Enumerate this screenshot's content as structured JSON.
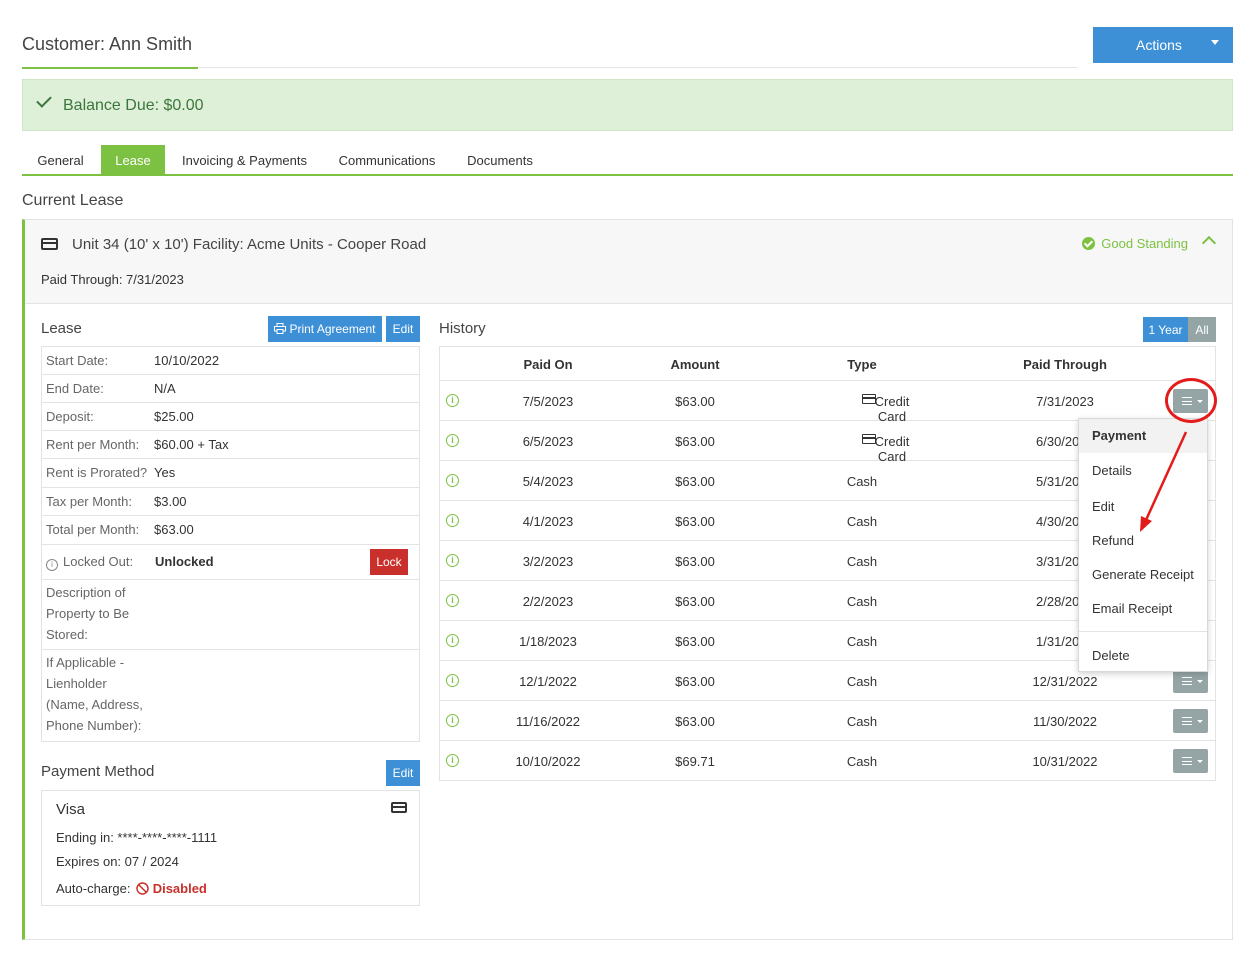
{
  "header": {
    "title": "Customer:  Ann Smith",
    "actions_label": "Actions"
  },
  "balance": {
    "text": "Balance Due:  $0.00"
  },
  "tabs": [
    {
      "label": "General"
    },
    {
      "label": "Lease"
    },
    {
      "label": "Invoicing & Payments"
    },
    {
      "label": "Communications"
    },
    {
      "label": "Documents"
    }
  ],
  "active_tab": "Lease",
  "current_lease_title": "Current Lease",
  "unit": {
    "title": "Unit 34 (10' x 10') Facility: Acme Units - Cooper Road",
    "paid_through": "Paid Through: 7/31/2023",
    "status": "Good Standing"
  },
  "lease": {
    "title": "Lease",
    "print_label": "Print Agreement",
    "edit_label": "Edit",
    "rows": [
      {
        "k": "Start Date:",
        "v": "10/10/2022"
      },
      {
        "k": "End Date:",
        "v": "N/A"
      },
      {
        "k": "Deposit:",
        "v": "$25.00"
      },
      {
        "k": "Rent per Month:",
        "v": "$60.00 + Tax"
      },
      {
        "k": "Rent is Prorated?",
        "v": "Yes"
      },
      {
        "k": "Tax per Month:",
        "v": "$3.00"
      },
      {
        "k": "Total per Month:",
        "v": "$63.00"
      }
    ],
    "locked_out_label": "Locked Out:",
    "locked_out_value": "Unlocked",
    "lock_label": "Lock",
    "description_label_1": "Description of",
    "description_label_2": "Property to Be",
    "description_label_3": "Stored:",
    "lien_label_1": "If Applicable -",
    "lien_label_2": "Lienholder",
    "lien_label_3": "(Name, Address,",
    "lien_label_4": "Phone Number):"
  },
  "payment_method": {
    "title": "Payment Method",
    "edit_label": "Edit",
    "card": "Visa",
    "ending": "Ending in: ****-****-****-1111",
    "expires": "Expires on: 07 / 2024",
    "autocharge_label": "Auto-charge:",
    "autocharge_value": "Disabled"
  },
  "history": {
    "title": "History",
    "range_year": "1 Year",
    "range_all": "All",
    "columns": [
      "Paid On",
      "Amount",
      "Type",
      "Paid Through"
    ],
    "rows": [
      {
        "paid_on": "7/5/2023",
        "amount": "$63.00",
        "type": "Credit Card",
        "paid_through": "7/31/2023"
      },
      {
        "paid_on": "6/5/2023",
        "amount": "$63.00",
        "type": "Credit Card",
        "paid_through": "6/30/20"
      },
      {
        "paid_on": "5/4/2023",
        "amount": "$63.00",
        "type": "Cash",
        "paid_through": "5/31/20"
      },
      {
        "paid_on": "4/1/2023",
        "amount": "$63.00",
        "type": "Cash",
        "paid_through": "4/30/20"
      },
      {
        "paid_on": "3/2/2023",
        "amount": "$63.00",
        "type": "Cash",
        "paid_through": "3/31/20"
      },
      {
        "paid_on": "2/2/2023",
        "amount": "$63.00",
        "type": "Cash",
        "paid_through": "2/28/20"
      },
      {
        "paid_on": "1/18/2023",
        "amount": "$63.00",
        "type": "Cash",
        "paid_through": "1/31/20"
      },
      {
        "paid_on": "12/1/2022",
        "amount": "$63.00",
        "type": "Cash",
        "paid_through": "12/31/2022"
      },
      {
        "paid_on": "11/16/2022",
        "amount": "$63.00",
        "type": "Cash",
        "paid_through": "11/30/2022"
      },
      {
        "paid_on": "10/10/2022",
        "amount": "$69.71",
        "type": "Cash",
        "paid_through": "10/31/2022"
      }
    ]
  },
  "dropdown": {
    "items": [
      "Payment",
      "Details",
      "Edit",
      "Refund",
      "Generate Receipt",
      "Email Receipt",
      "Delete"
    ]
  },
  "colors": {
    "accent_green": "#7cc142",
    "primary_blue": "#3d8fd6",
    "danger_red": "#c9302c",
    "annotation_red": "#e31b1b"
  },
  "icons": [
    "check-icon",
    "storage-unit-icon",
    "good-standing-icon",
    "chevron-up-icon",
    "printer-icon",
    "info-icon",
    "credit-card-icon",
    "menu-icon",
    "ban-icon"
  ]
}
